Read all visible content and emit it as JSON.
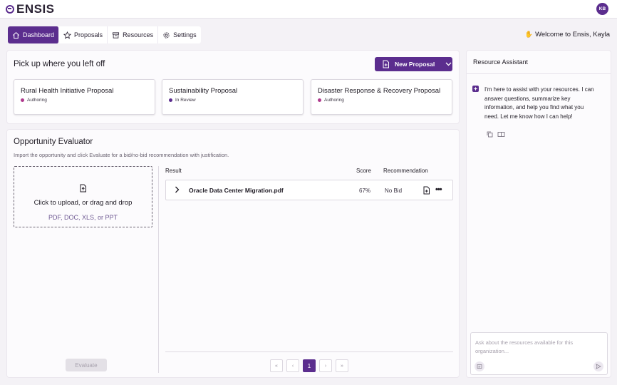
{
  "brand": {
    "name": "ENSIS",
    "accent": "#5b2d8e"
  },
  "user": {
    "initials": "KB",
    "welcome": "Welcome to Ensis, Kayla",
    "welcome_icon": "waving-hand-icon"
  },
  "nav": {
    "items": [
      {
        "label": "Dashboard",
        "icon": "home-icon",
        "active": true
      },
      {
        "label": "Proposals",
        "icon": "star-icon"
      },
      {
        "label": "Resources",
        "icon": "archive-icon"
      },
      {
        "label": "Settings",
        "icon": "gear-icon"
      }
    ]
  },
  "pickup": {
    "title": "Pick up where you left off",
    "new_proposal_label": "New Proposal",
    "proposals": [
      {
        "title": "Rural Health Initiative Proposal",
        "status": "Authoring"
      },
      {
        "title": "Sustainability Proposal",
        "status": "In Review"
      },
      {
        "title": "Disaster Response & Recovery Proposal",
        "status": "Authoring"
      }
    ]
  },
  "evaluator": {
    "title": "Opportunity Evaluator",
    "subtitle": "Import the opportunity and click Evaluate for a bid/no-bid recommendation with justification.",
    "upload": {
      "main": "Click to upload, or drag and drop",
      "types": "PDF, DOC, XLS, or PPT"
    },
    "columns": {
      "result": "Result",
      "score": "Score",
      "recommendation": "Recommendation"
    },
    "results": [
      {
        "file": "Oracle Data Center Migration.pdf",
        "score": "67%",
        "recommendation": "No Bid"
      }
    ],
    "pager": {
      "first": "«",
      "prev": "‹",
      "current": "1",
      "next": "›",
      "last": "»"
    },
    "evaluate_label": "Evaluate"
  },
  "assistant": {
    "title": "Resource Assistant",
    "message": "I'm here to assist with your resources. I can answer questions, summarize key information, and help you find what you need. Let me know how I can help!",
    "input_placeholder": "Ask about the resources available for this organization..."
  }
}
